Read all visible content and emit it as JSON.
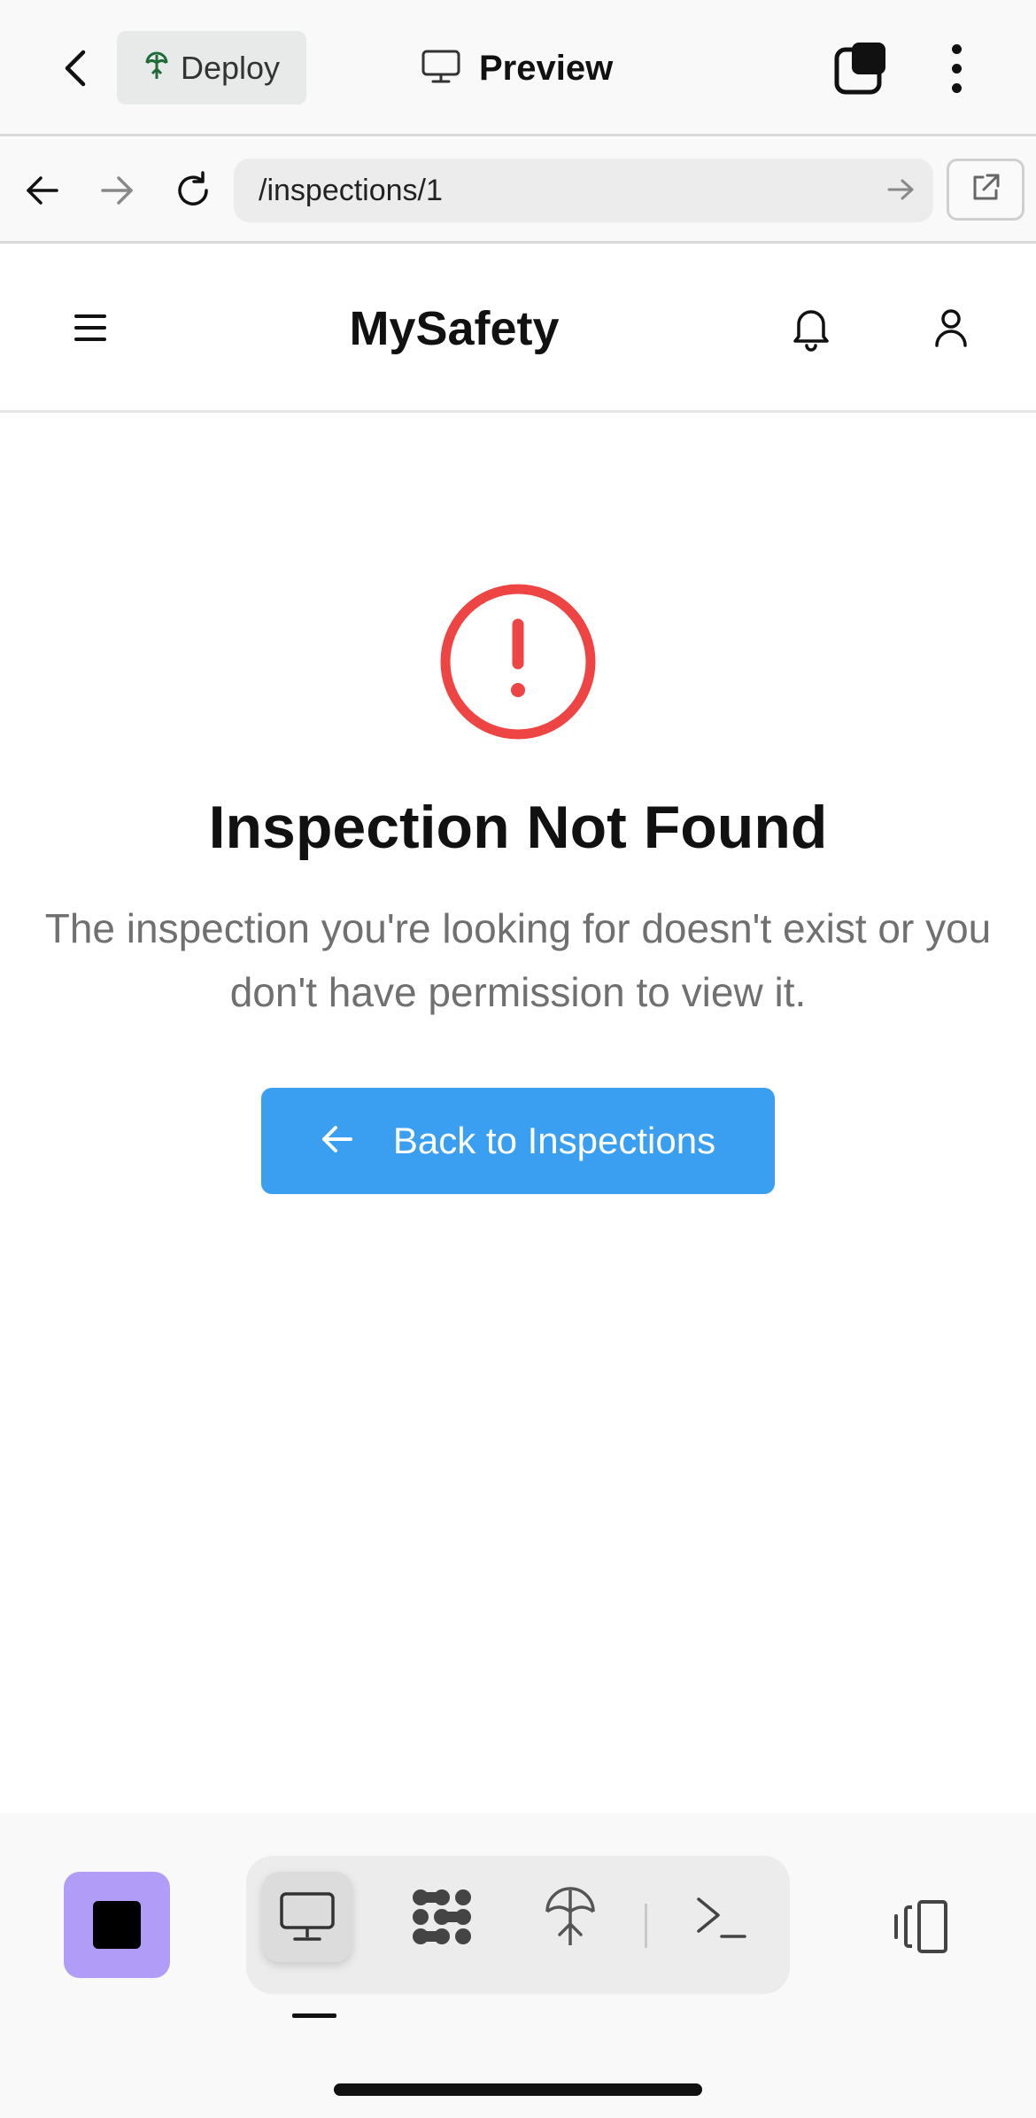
{
  "topbar": {
    "deploy_label": "Deploy",
    "preview_label": "Preview"
  },
  "addressbar": {
    "url": "/inspections/1"
  },
  "app": {
    "brand": "MySafety"
  },
  "error": {
    "title": "Inspection Not Found",
    "message": "The inspection you're looking for doesn't exist or you don't have permission to view it.",
    "back_label": "Back to Inspections"
  },
  "colors": {
    "accent": "#3a9ff0",
    "error": "#ee4444",
    "stop": "#b19cf7"
  }
}
